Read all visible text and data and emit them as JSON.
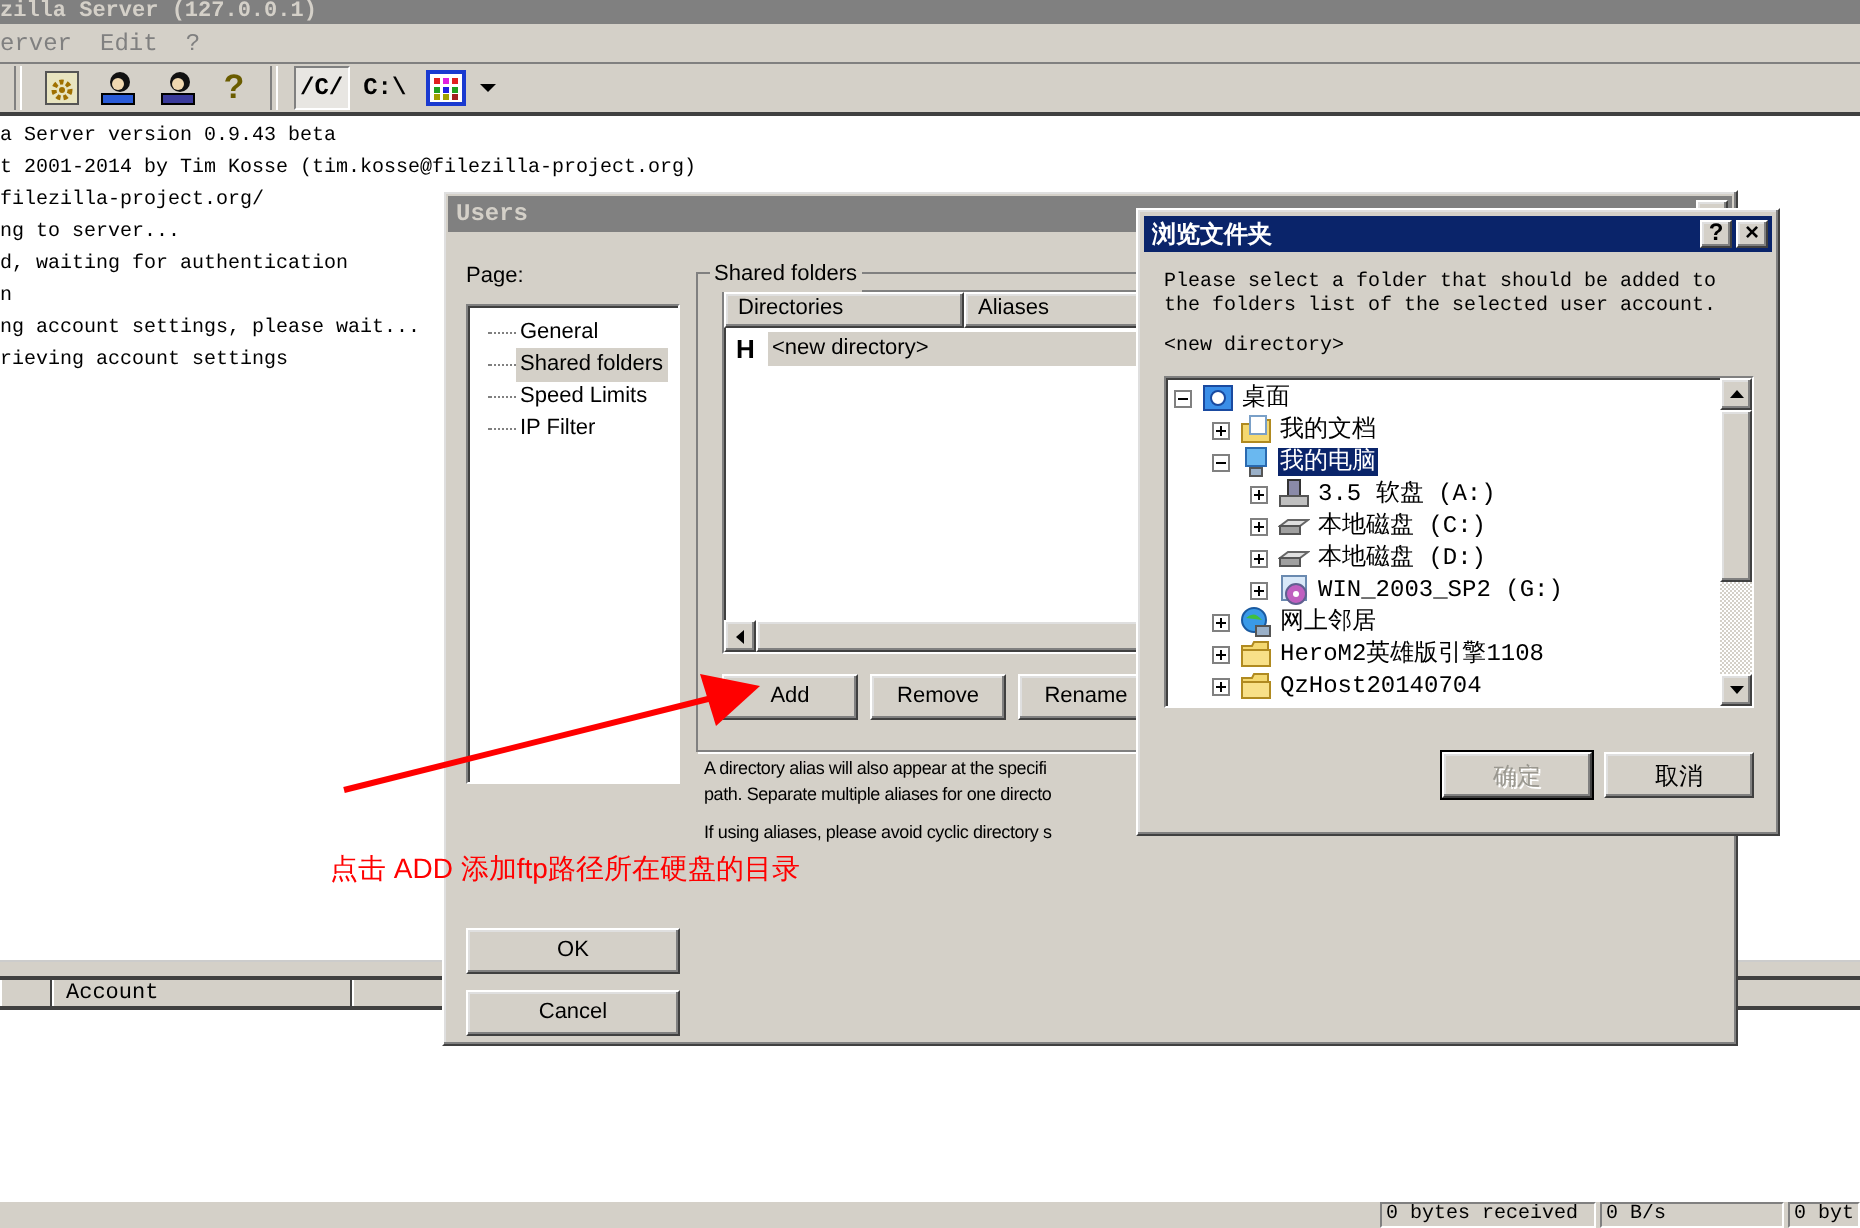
{
  "main_window": {
    "title": "zilla Server (127.0.0.1)",
    "menu": [
      "erver",
      "Edit",
      "?"
    ],
    "toolbar": [
      {
        "kind": "settings"
      },
      {
        "kind": "user"
      },
      {
        "kind": "users"
      },
      {
        "kind": "help",
        "label": "?"
      },
      {
        "kind": "separator"
      },
      {
        "kind": "text",
        "label": "/C/",
        "selected": true
      },
      {
        "kind": "text",
        "label": "C:\\",
        "selected": false
      },
      {
        "kind": "palette"
      },
      {
        "kind": "dropdown"
      }
    ],
    "log": [
      "a Server version 0.9.43 beta",
      "t 2001-2014 by Tim Kosse (tim.kosse@filezilla-project.org)",
      "filezilla-project.org/",
      "ng to server...",
      "d, waiting for authentication",
      "n",
      "ng account settings, please wait...",
      "rieving account settings"
    ],
    "sessions": {
      "columns": [
        "Account"
      ]
    },
    "status_bar": [
      "0 bytes received",
      "0 B/s",
      "0 byt"
    ]
  },
  "users_dialog": {
    "title": "Users",
    "page_label": "Page:",
    "pages": [
      {
        "label": "General",
        "selected": false
      },
      {
        "label": "Shared folders",
        "selected": true
      },
      {
        "label": "Speed Limits",
        "selected": false
      },
      {
        "label": "IP Filter",
        "selected": false
      }
    ],
    "group_title": "Shared folders",
    "columns": [
      "Directories",
      "Aliases"
    ],
    "rows": [
      {
        "marker": "H",
        "directory": "<new directory>",
        "selected": true
      }
    ],
    "buttons": [
      "Add",
      "Remove",
      "Rename"
    ],
    "help": [
      "A directory alias will also appear at the specifi",
      "path. Separate multiple aliases for one directo",
      "If using aliases, please avoid cyclic directory s"
    ],
    "ok": "OK",
    "cancel": "Cancel"
  },
  "browse_dialog": {
    "title": "浏览文件夹",
    "help_glyph": "?",
    "close_glyph": "×",
    "prompt": [
      "Please select a folder that should be added to",
      "the folders list of the selected user account."
    ],
    "current": "<new directory>",
    "tree": [
      {
        "label": "桌面",
        "kind": "desktop",
        "expanded": true,
        "selected": false,
        "children": [
          {
            "label": "我的文档",
            "kind": "documents",
            "expanded": false,
            "selected": false
          },
          {
            "label": "我的电脑",
            "kind": "computer",
            "expanded": true,
            "selected": true,
            "children": [
              {
                "label": "3.5 软盘 (A:)",
                "kind": "floppy",
                "expanded": false,
                "selected": false
              },
              {
                "label": "本地磁盘 (C:)",
                "kind": "disk",
                "expanded": false,
                "selected": false
              },
              {
                "label": "本地磁盘 (D:)",
                "kind": "disk",
                "expanded": false,
                "selected": false
              },
              {
                "label": "WIN_2003_SP2 (G:)",
                "kind": "cdrom",
                "expanded": false,
                "selected": false
              }
            ]
          },
          {
            "label": "网上邻居",
            "kind": "network",
            "expanded": false,
            "selected": false
          },
          {
            "label": "HeroM2英雄版引擎1108",
            "kind": "folder",
            "expanded": false,
            "selected": false
          },
          {
            "label": "QzHost20140704",
            "kind": "folder",
            "expanded": false,
            "selected": false
          }
        ]
      }
    ],
    "buttons": [
      {
        "label": "确定",
        "disabled": true
      },
      {
        "label": "取消",
        "disabled": false
      }
    ]
  },
  "annotation": {
    "text": "点击 ADD  添加ftp路径所在硬盘的目录"
  }
}
